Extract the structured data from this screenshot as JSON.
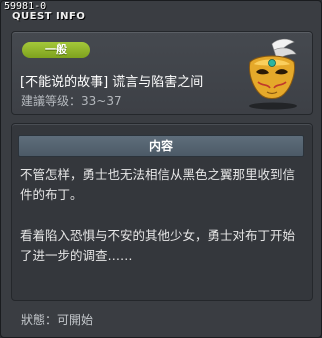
{
  "window": {
    "quest_id": "59981-0",
    "title": "QUEST INFO"
  },
  "quest": {
    "category": "一般",
    "name": "[不能说的故事] 谎言与陷害之间",
    "level": "建議等级：33~37",
    "icon": "golden-mask-icon"
  },
  "content": {
    "header": "内容",
    "paragraph_1": "不管怎样，勇士也无法相信从黑色之翼那里收到信件的布丁。",
    "paragraph_2": "看着陷入恐惧与不安的其他少女，勇士对布丁开始了进一步的调查……"
  },
  "status": {
    "text": "狀態：可開始"
  },
  "colors": {
    "badge_green": "#8fb52a",
    "header_blue": "#55636f",
    "background": "#3a3d42"
  }
}
